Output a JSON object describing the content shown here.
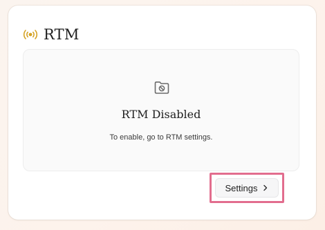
{
  "card": {
    "title": "RTM",
    "title_icon": "broadcast-signal-icon",
    "accent_color": "#d4a224"
  },
  "status_panel": {
    "icon": "folder-prohibited-icon",
    "heading": "RTM Disabled",
    "description": "To enable, go to RTM settings."
  },
  "actions": {
    "settings_label": "Settings",
    "settings_icon": "chevron-right-icon",
    "highlight_color": "#e26d8e"
  }
}
